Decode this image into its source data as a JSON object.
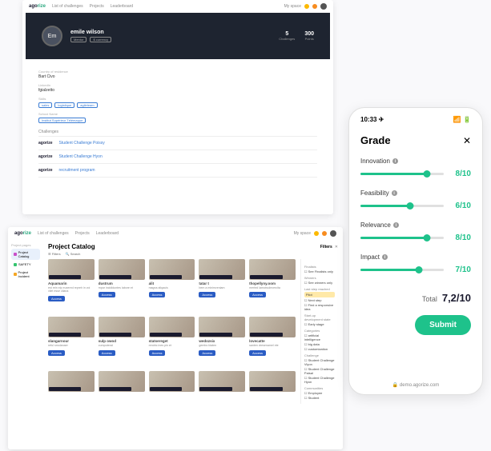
{
  "brand": {
    "name_a": "ago",
    "name_b": "rize"
  },
  "topnav": {
    "links": [
      "List of challenges",
      "Projects",
      "Leaderboard"
    ],
    "myspace": "My space"
  },
  "profile": {
    "initials": "Em",
    "name": "emile wilson",
    "badge1": "Mentor",
    "currency": "$ currency",
    "stats": [
      {
        "n": "5",
        "l": "Challenges"
      },
      {
        "n": "300",
        "l": "Points"
      }
    ],
    "country_label": "Country of residence",
    "country": "Bart Civo",
    "linkedin_label": "LinkedIn",
    "linkedin": "fgialzetto",
    "skills_label": "Skills",
    "skills": [
      "sales",
      "logistique",
      "agileteam"
    ],
    "school_label": "School Name",
    "school": "Institut Supérieur Télémaque",
    "challenges_h": "Challenges",
    "challenges": [
      "Student Challenge Poissy",
      "Student Challenge Hyon",
      "recruitment program"
    ]
  },
  "catalog": {
    "title": "Project Catalog",
    "sidebar_h": "Project pages",
    "sidebar": [
      {
        "label": "Project Catalog",
        "color": "#c94fc9",
        "active": true
      },
      {
        "label": "SAFETY",
        "color": "#36c46f",
        "active": false
      },
      {
        "label": "Project Incident",
        "color": "#f5a623",
        "active": false
      }
    ],
    "tool_filters": "Filters",
    "tool_search": "Search",
    "filters_h": "Filters",
    "filters": {
      "sec1": "Finalists",
      "opt1": "See Finalists only",
      "sec2": "Winners",
      "opt2": "See winners only",
      "sec3": "Last step reached",
      "opt3a": "Next step",
      "opt3b": "Find a responsive idea",
      "sec4": "Start-up development state",
      "opt4a": "Early stage",
      "sec5": "Categories",
      "opt5a": "artificial intelligence",
      "opt5b": "big data",
      "opt5c": "customization",
      "sec6": "Challenge",
      "opt6a": "Student Challenge Viyon",
      "opt6b": "Student Challenge Paisal",
      "opt6c": "Student Challenge Hyon",
      "sec7": "Communities",
      "opt7a": "Employee",
      "opt7b": "Student",
      "badge": "Pilot"
    },
    "cards": [
      {
        "t": "Aquamarin",
        "s": "est rein eip euxered repreh in voi vilet esse cllana",
        "b": "Access"
      },
      {
        "t": "dustrum",
        "s": "mpar incididuntes labore et",
        "b": "Access"
      },
      {
        "t": "alit",
        "s": "magna aliqauis",
        "b": "Access"
      },
      {
        "t": "tatar t",
        "s": "bem a minimveniam",
        "b": "Access"
      },
      {
        "t": "thopellyny.oom",
        "s": "merted lamotrudexercita",
        "b": "Access"
      },
      {
        "t": "slangarnour",
        "s": "reful smolanaer",
        "b": "Access"
      },
      {
        "t": "sulp owod",
        "s": "cumputerat",
        "b": "Access"
      },
      {
        "t": "statsereget",
        "s": "rendric ines pin et",
        "b": "Access"
      },
      {
        "t": "wedozsix",
        "s": "gembo blaten",
        "b": "Access"
      },
      {
        "t": "lovecatte",
        "s": "santen dresenamel ete",
        "b": "Access"
      }
    ]
  },
  "phone": {
    "time": "10:33",
    "title": "Grade",
    "criteria": [
      {
        "label": "Innovation",
        "score": "8/10",
        "pct": 80
      },
      {
        "label": "Feasibility",
        "score": "6/10",
        "pct": 60
      },
      {
        "label": "Relevance",
        "score": "8/10",
        "pct": 80
      },
      {
        "label": "Impact",
        "score": "7/10",
        "pct": 70
      }
    ],
    "total_l": "Total",
    "total_v": "7,2/10",
    "submit": "Submit",
    "url": "demo.agorize.com"
  }
}
